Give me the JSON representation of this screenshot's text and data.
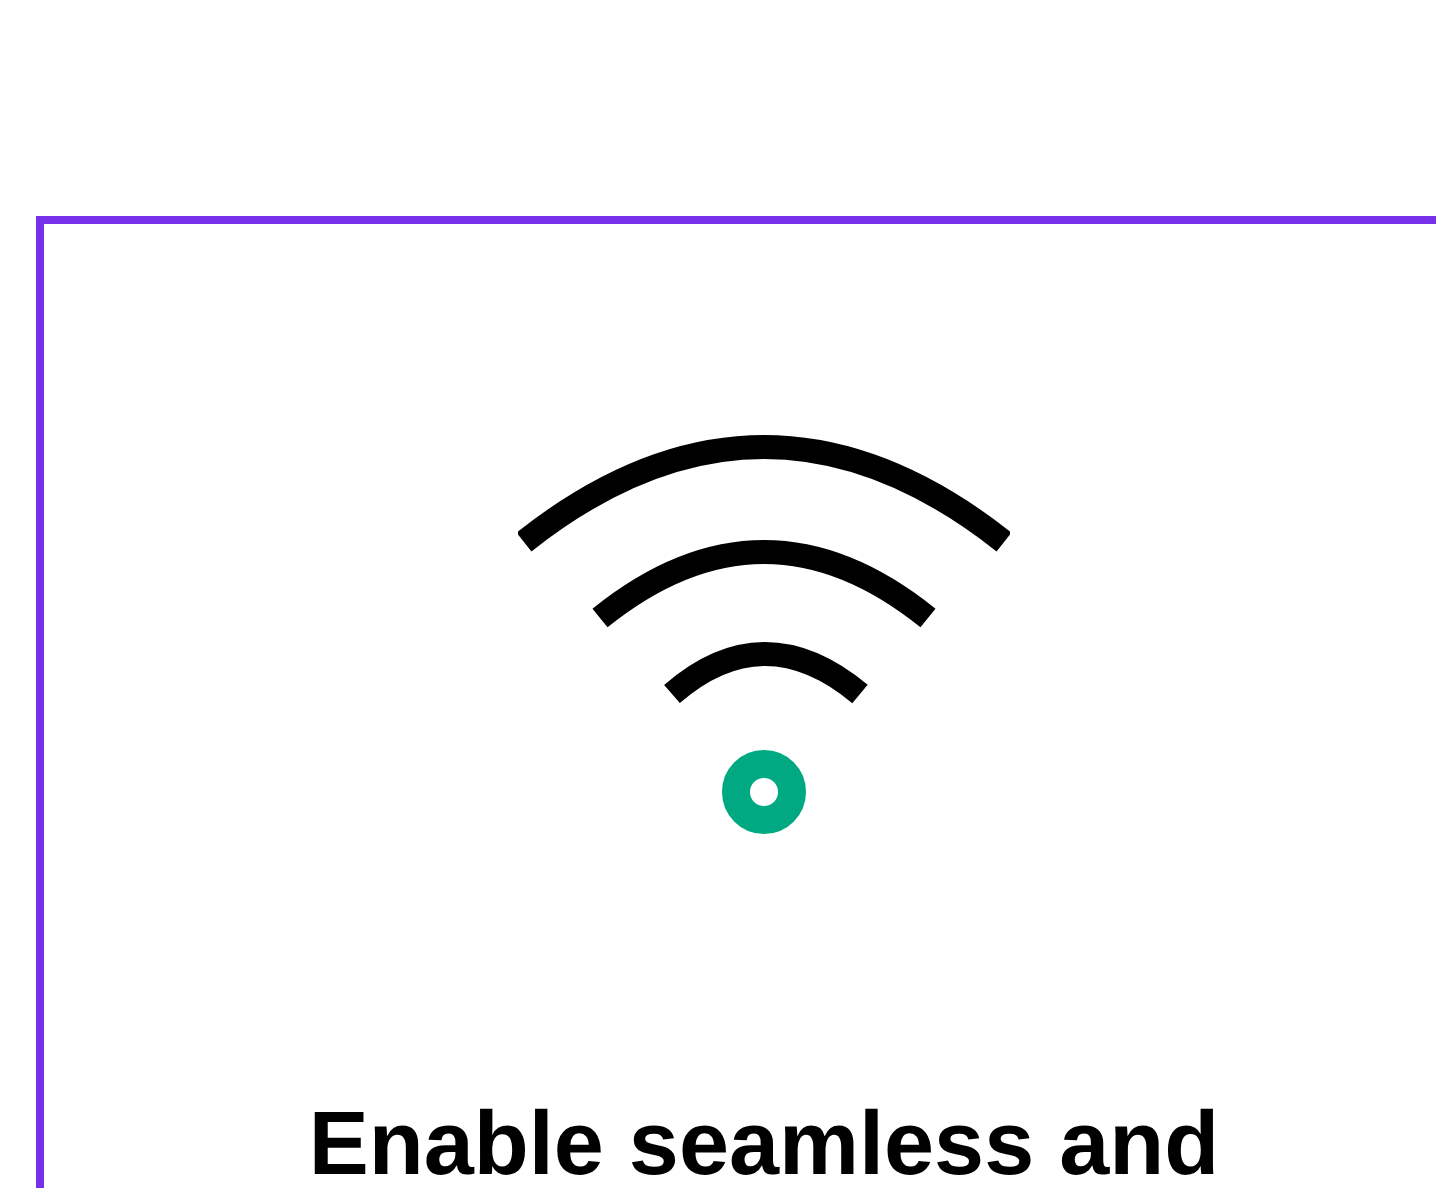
{
  "card": {
    "heading": "Enable seamless and"
  }
}
